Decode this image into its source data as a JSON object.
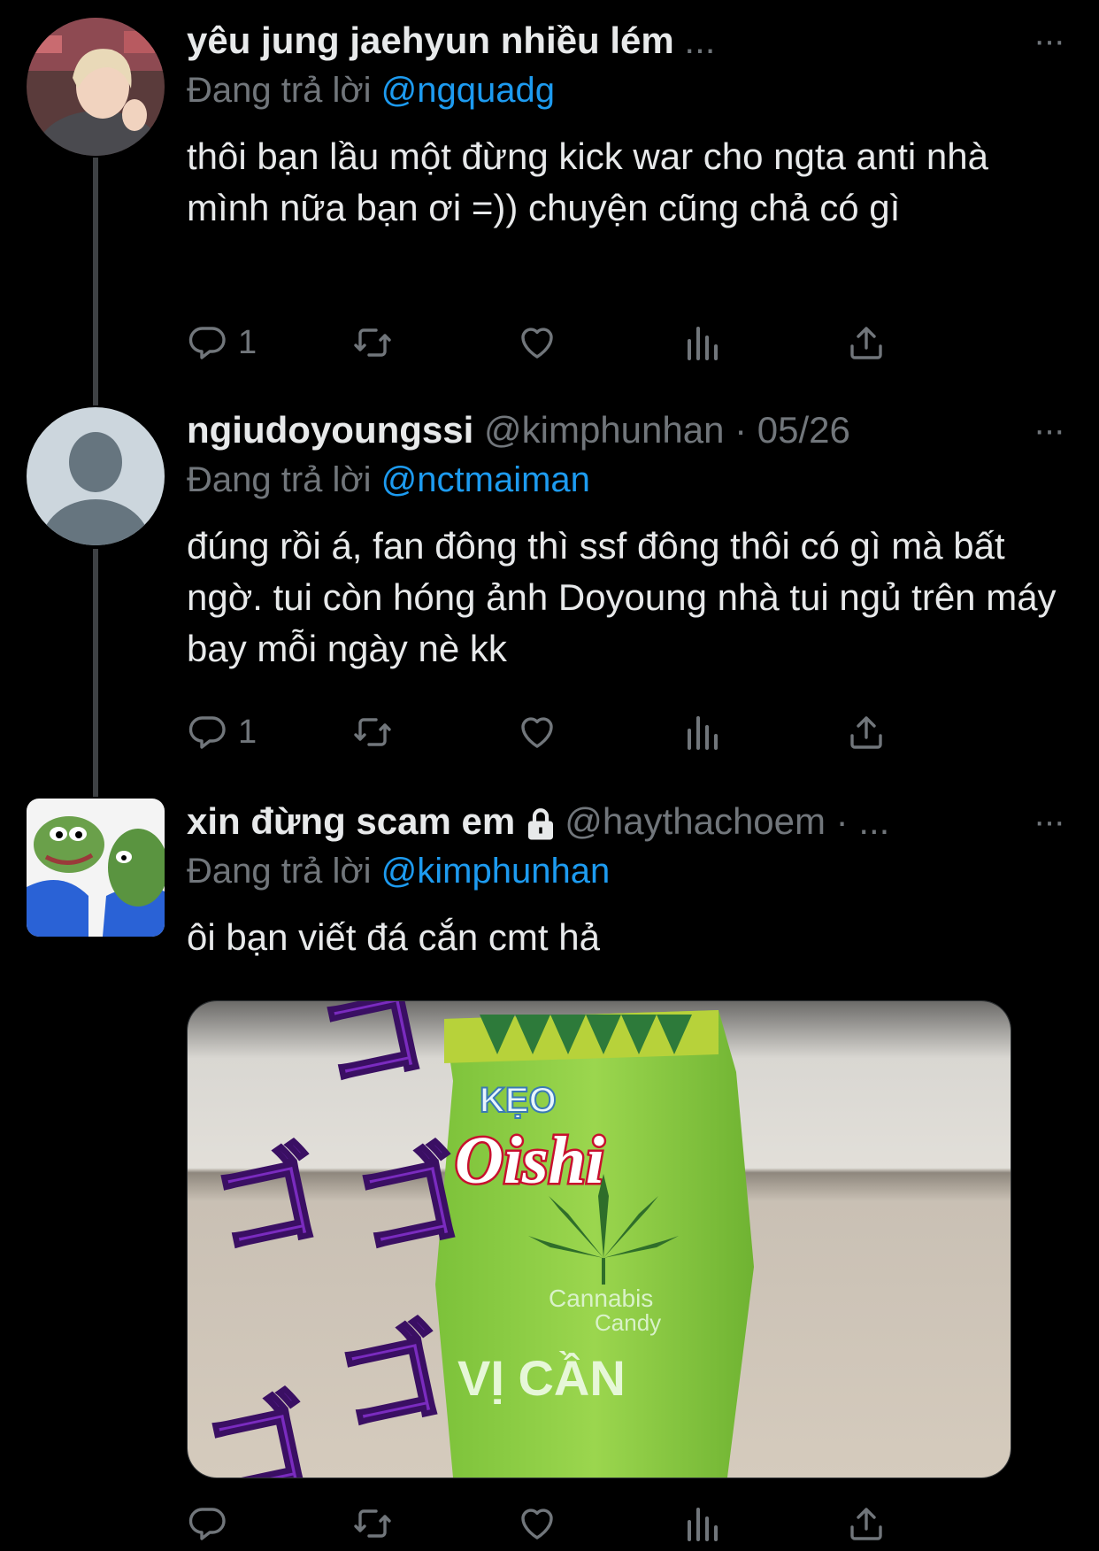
{
  "tweets": [
    {
      "name": "yêu jung jaehyun nhiều lém",
      "name_trail": " ...",
      "handle_line": "",
      "reply_prefix": "Đang trả lời",
      "reply_to": "@ngquadg",
      "text": "thôi bạn lầu một đừng kick war cho ngta anti nhà mình nữa bạn ơi =)) chuyện cũng chả có gì",
      "reply_count": "1",
      "avatar_icon": "person-photo-avatar"
    },
    {
      "name": "ngiudoyoungssi",
      "handle_line": "@kimphunhan · 05/26",
      "reply_prefix": "Đang trả lời",
      "reply_to": "@nctmaiman",
      "text": "đúng rồi á, fan đông thì ssf đông thôi có gì mà bất ngờ. tui còn hóng ảnh Doyoung nhà tui ngủ trên máy bay mỗi ngày nè kk",
      "reply_count": "1",
      "avatar_icon": "default-avatar"
    },
    {
      "name": "xin đừng scam em",
      "handle_line": "@haythachoem · ...",
      "reply_prefix": "Đang trả lời",
      "reply_to": "@kimphunhan",
      "text": "ôi bạn viết đá cắn cmt hả",
      "avatar_icon": "pepe-frog-avatar"
    }
  ],
  "media": {
    "brand": "Oishi",
    "top_label": "KẸO",
    "product": "Cannabis",
    "product_line2": "Candy",
    "flavor": "VỊ CẦN",
    "overlay_symbol": "ゴ"
  },
  "more_label": "···",
  "colors": {
    "background": "#000000",
    "text": "#e7e9ea",
    "secondary": "#71767b",
    "link": "#1d9bf0"
  },
  "icons": [
    "reply-icon",
    "retweet-icon",
    "like-icon",
    "views-icon",
    "share-icon",
    "more-icon",
    "lock-icon"
  ]
}
